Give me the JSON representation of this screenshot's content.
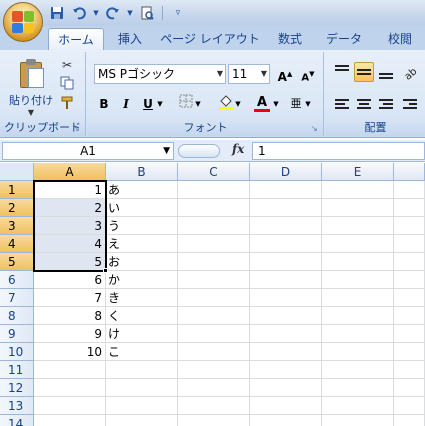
{
  "ribbon_tabs": [
    "ホーム",
    "挿入",
    "ページ レイアウト",
    "数式",
    "データ",
    "校閲"
  ],
  "active_tab": "ホーム",
  "clipboard": {
    "paste_label": "貼り付け",
    "group_label": "クリップボード"
  },
  "font": {
    "name": "MS Pゴシック",
    "size": "11",
    "group_label": "フォント",
    "bold": "B",
    "italic": "I",
    "underline": "U",
    "grow": "A",
    "shrink": "A"
  },
  "alignment": {
    "group_label": "配置"
  },
  "formula_bar": {
    "name_box": "A1",
    "fx": "fx",
    "value": "1"
  },
  "columns": [
    "A",
    "B",
    "C",
    "D",
    "E"
  ],
  "rows": [
    "1",
    "2",
    "3",
    "4",
    "5",
    "6",
    "7",
    "8",
    "9",
    "10",
    "11",
    "12",
    "13",
    "14"
  ],
  "cells": {
    "A": [
      "1",
      "2",
      "3",
      "4",
      "5",
      "6",
      "7",
      "8",
      "9",
      "10"
    ],
    "B": [
      "あ",
      "い",
      "う",
      "え",
      "お",
      "か",
      "き",
      "く",
      "け",
      "こ"
    ]
  },
  "colors": {
    "accent": "#15428b",
    "selection": "#f1c15f"
  },
  "icons": [
    "office-logo-icon",
    "save-icon",
    "undo-icon",
    "redo-icon",
    "print-preview-icon",
    "cut-icon",
    "copy-icon",
    "format-painter-icon",
    "border-icon",
    "fill-color-icon",
    "font-color-icon",
    "phonetic-icon",
    "align-top-icon",
    "align-middle-icon",
    "align-bottom-icon",
    "orientation-icon",
    "align-left-icon",
    "align-center-icon",
    "align-right-icon"
  ]
}
